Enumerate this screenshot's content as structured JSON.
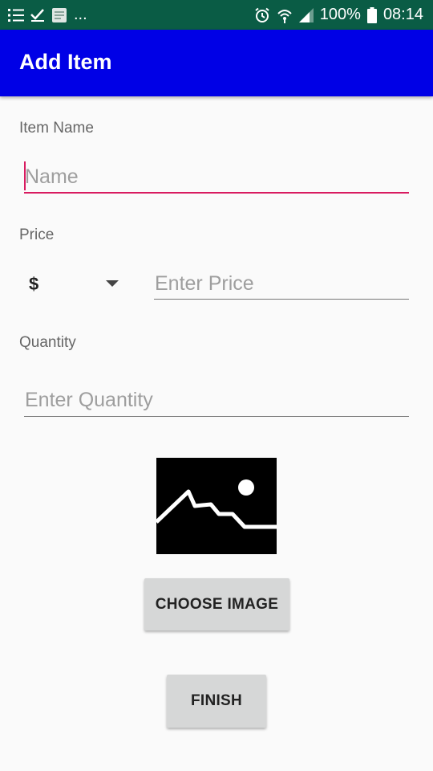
{
  "status_bar": {
    "left_icons": [
      "list-icon",
      "check-icon",
      "notification-app-icon"
    ],
    "more": "...",
    "right_icons": [
      "alarm-icon",
      "wifi-icon",
      "signal-icon"
    ],
    "battery": "100%",
    "time": "08:14"
  },
  "app_bar": {
    "title": "Add Item",
    "color": "#0000e6"
  },
  "form": {
    "item_name": {
      "label": "Item Name",
      "placeholder": "Name"
    },
    "price": {
      "label": "Price",
      "currency": "$",
      "placeholder": "Enter Price"
    },
    "quantity": {
      "label": "Quantity",
      "placeholder": "Enter Quantity"
    }
  },
  "image": {
    "icon": "image-placeholder-icon"
  },
  "buttons": {
    "choose_image": "CHOOSE IMAGE",
    "finish": "FINISH"
  },
  "colors": {
    "accent": "#d81b60",
    "status_bar": "#0a5c45",
    "background": "#fafafa"
  }
}
